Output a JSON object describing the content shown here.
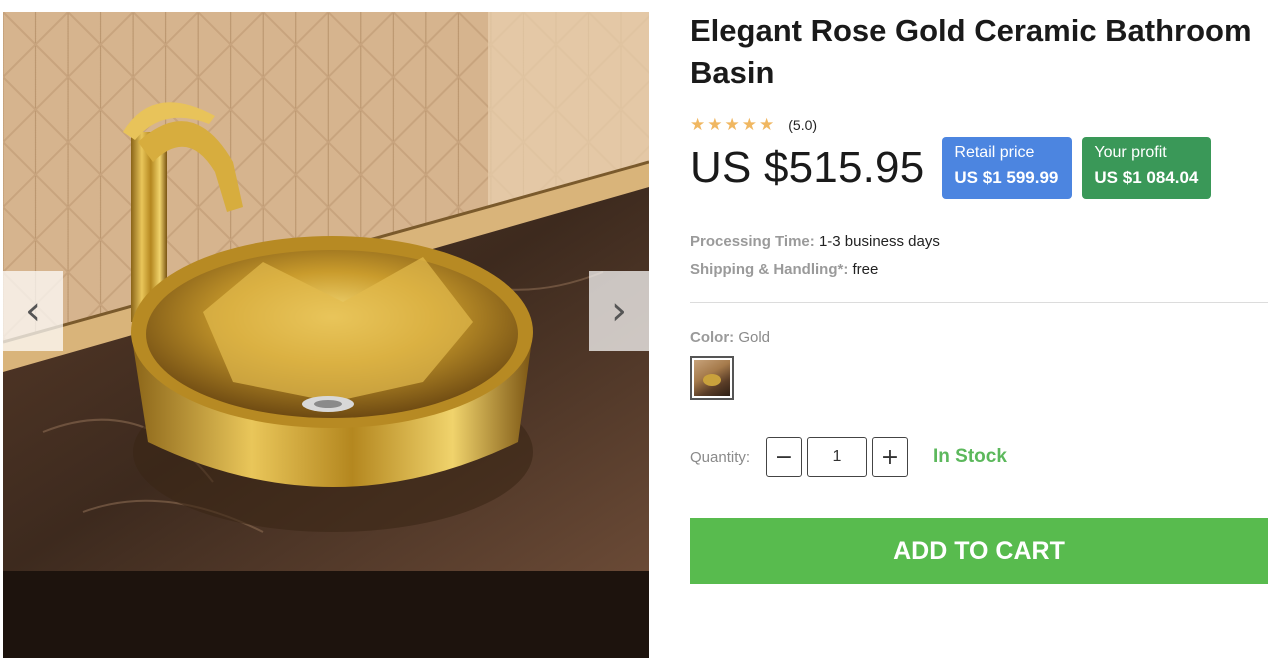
{
  "gallery": {
    "prev_icon": "chevron-left-icon",
    "next_icon": "chevron-right-icon",
    "prev_glyph": "‹",
    "next_glyph": "›"
  },
  "product": {
    "title": "Elegant Rose Gold Ceramic Bathroom Basin",
    "rating": 5,
    "rating_text": "(5.0)",
    "price": "US $515.95",
    "retail": {
      "label": "Retail price",
      "value": "US $1 599.99",
      "color": "#4c85e0"
    },
    "profit": {
      "label": "Your profit",
      "value": "US $1 084.04",
      "color": "#3a9858"
    },
    "processing_label": "Processing Time:",
    "processing_value": "1-3 business days",
    "shipping_label": "Shipping & Handling*:",
    "shipping_value": "free",
    "color_label": "Color:",
    "color_value": "Gold",
    "quantity_label": "Quantity:",
    "quantity_value": "1",
    "minus_glyph": "−",
    "plus_glyph": "+",
    "stock_status": "In Stock",
    "stock_color": "#5cb85c",
    "add_to_cart_label": "ADD TO CART",
    "add_to_cart_color": "#58bb4e"
  }
}
